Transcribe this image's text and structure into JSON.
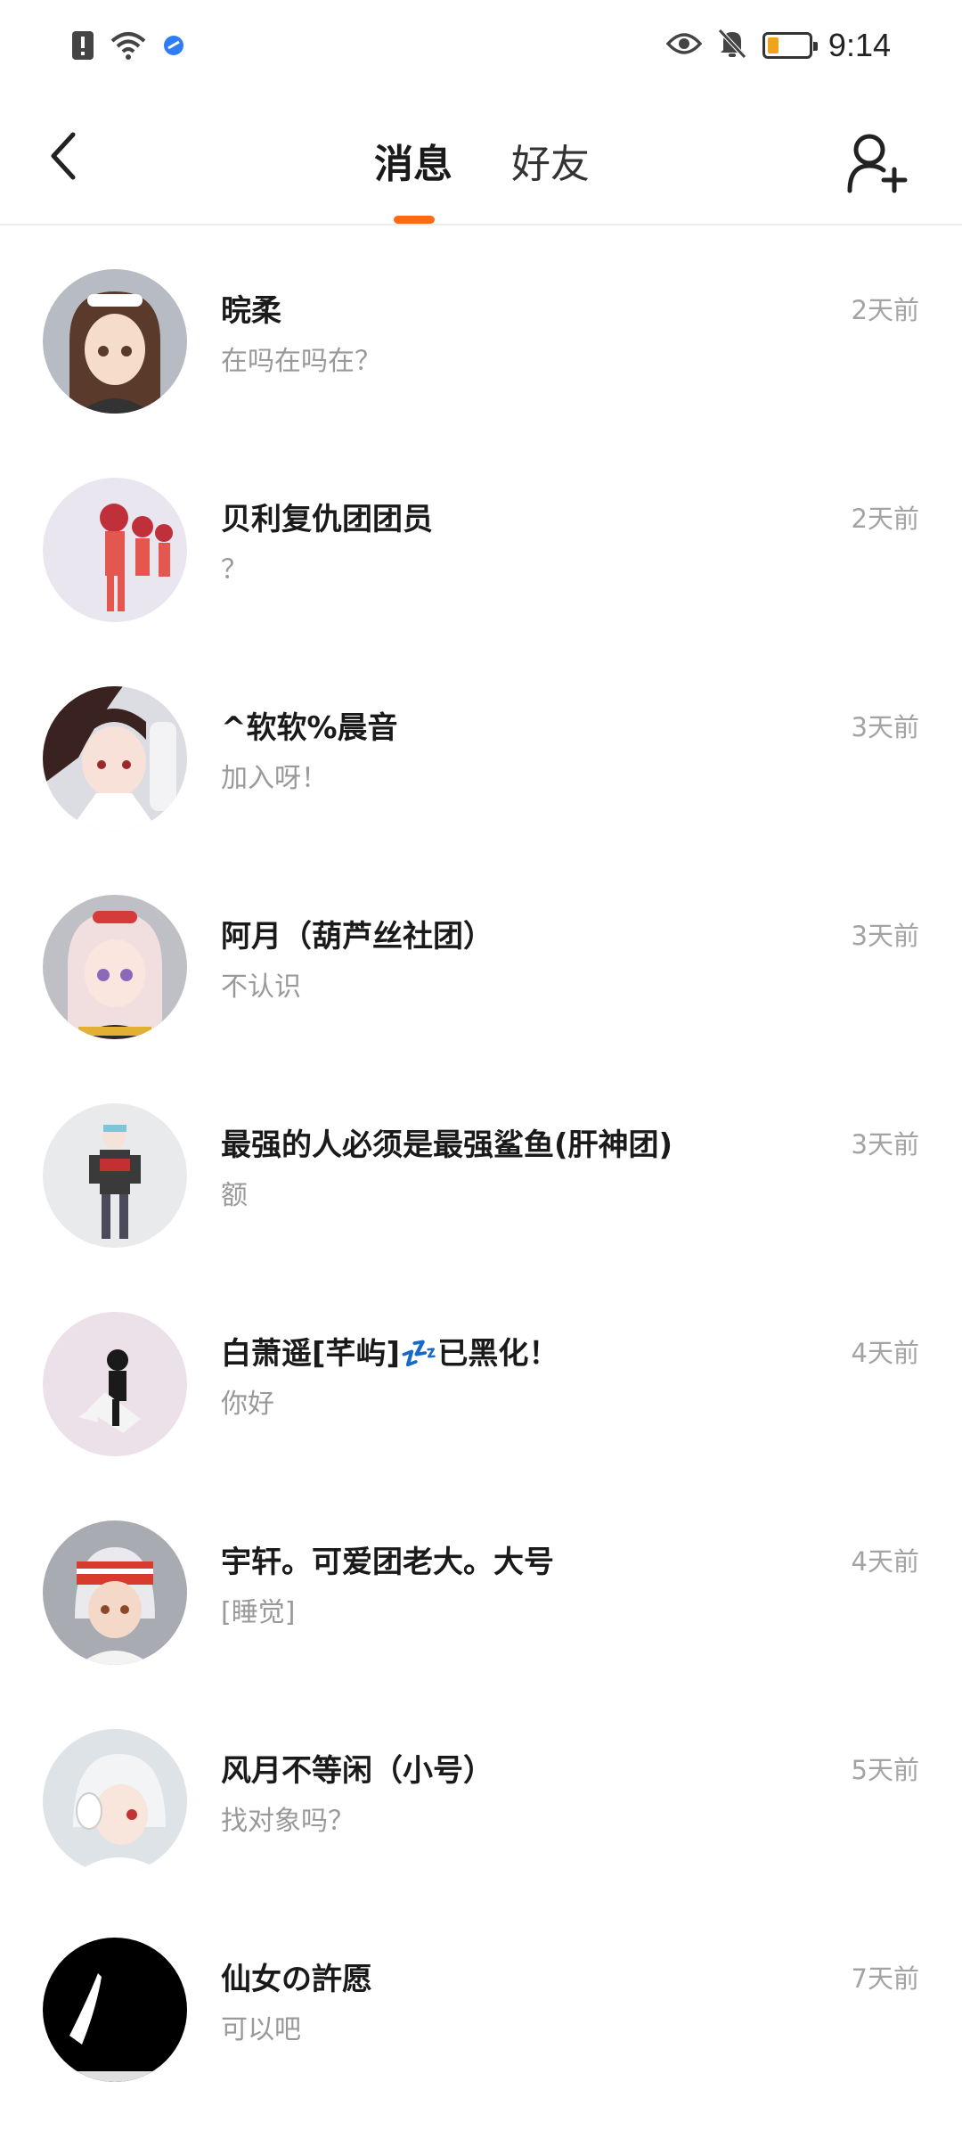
{
  "status_bar": {
    "time": "9:14",
    "icons": [
      "alert-icon",
      "wifi-icon",
      "app-notification-icon",
      "eye-icon",
      "mute-bell-icon",
      "battery-icon"
    ],
    "battery_color": "#f2a31b"
  },
  "header": {
    "tabs": [
      {
        "label": "消息",
        "active": true
      },
      {
        "label": "好友",
        "active": false
      }
    ],
    "accent": "#ff6a13"
  },
  "conversations": [
    {
      "name": "晥柔",
      "preview": "在吗在吗在？",
      "time": "2天前"
    },
    {
      "name": "贝利复仇团团员",
      "preview": "？",
      "time": "2天前"
    },
    {
      "name": "^软软%晨音",
      "preview": "加入呀！",
      "time": "3天前"
    },
    {
      "name": "阿月（葫芦丝社团）",
      "preview": "不认识",
      "time": "3天前"
    },
    {
      "name": "最强的人必须是最强鲨鱼(肝神团)",
      "preview": "额",
      "time": "3天前"
    },
    {
      "name": "白萧遥[芊屿]💤已黑化！",
      "preview": "你好",
      "time": "4天前"
    },
    {
      "name": "宇轩。可爱团老大。大号",
      "preview": "[睡觉]",
      "time": "4天前"
    },
    {
      "name": "风月不等闲（小号）",
      "preview": "找对象吗？",
      "time": "5天前"
    },
    {
      "name": "仙女の許愿",
      "preview": "可以吧",
      "time": "7天前"
    }
  ]
}
